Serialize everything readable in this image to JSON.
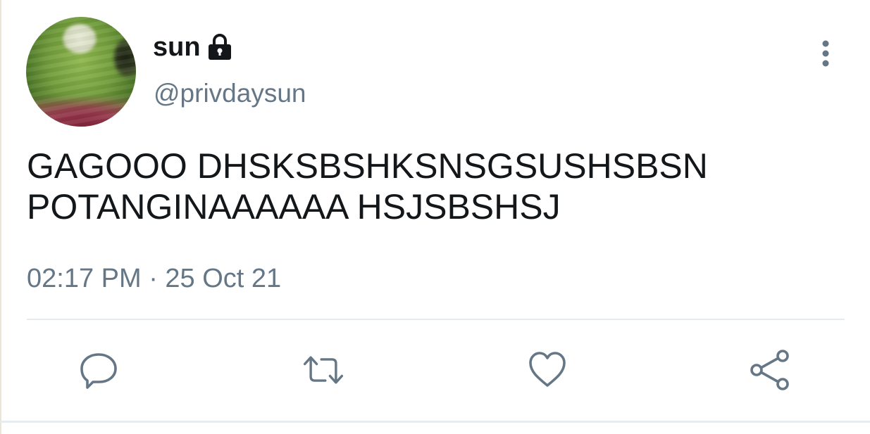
{
  "user": {
    "display_name": "sun",
    "handle": "@privdaysun",
    "protected_icon": "lock-icon",
    "avatar_icon": "avatar-photo"
  },
  "tweet": {
    "text": "GAGOOO DHSKSBSHKSNSGSUSHSBSN\nPOTANGINAAAAAA HSJSBSHSJ",
    "timestamp": "02:17 PM · 25 Oct 21"
  },
  "actions": [
    {
      "name": "reply",
      "icon": "reply-icon"
    },
    {
      "name": "retweet",
      "icon": "retweet-icon"
    },
    {
      "name": "like",
      "icon": "heart-icon"
    },
    {
      "name": "share",
      "icon": "share-icon"
    }
  ],
  "menu": {
    "icon": "more-vertical-icon"
  },
  "colors": {
    "text_primary": "#14171a",
    "text_secondary": "#657786",
    "divider": "#e6ecf0",
    "icon": "#657786"
  }
}
